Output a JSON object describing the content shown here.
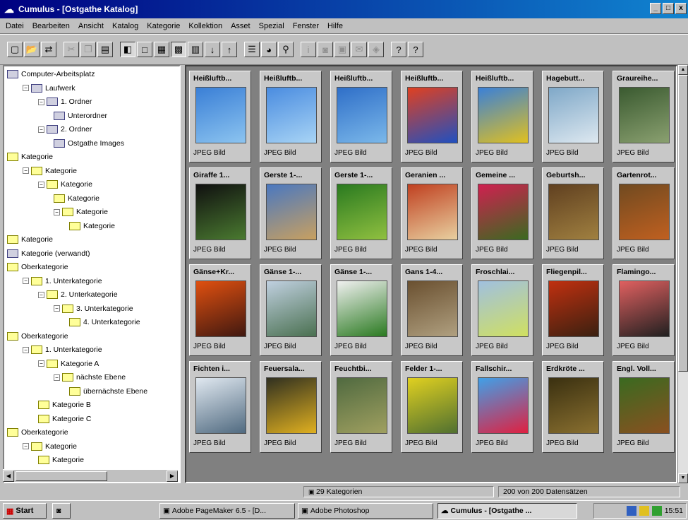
{
  "window": {
    "title": "Cumulus - [Ostgathe Katalog]",
    "min": "_",
    "max": "□",
    "close": "x"
  },
  "menu": [
    "Datei",
    "Bearbeiten",
    "Ansicht",
    "Katalog",
    "Kategorie",
    "Kollektion",
    "Asset",
    "Spezial",
    "Fenster",
    "Hilfe"
  ],
  "tree": [
    {
      "label": "Computer-Arbeitsplatz",
      "depth": 0,
      "exp": "",
      "type": "drive"
    },
    {
      "label": "Laufwerk",
      "depth": 1,
      "exp": "−",
      "type": "drive"
    },
    {
      "label": "1. Ordner",
      "depth": 2,
      "exp": "−",
      "type": "drive"
    },
    {
      "label": "Unterordner",
      "depth": 3,
      "exp": "",
      "type": "drive"
    },
    {
      "label": "2. Ordner",
      "depth": 2,
      "exp": "−",
      "type": "drive"
    },
    {
      "label": "Ostgathe Images",
      "depth": 3,
      "exp": "",
      "type": "drive"
    },
    {
      "label": "Kategorie",
      "depth": 0,
      "exp": "",
      "type": "folder"
    },
    {
      "label": "Kategorie",
      "depth": 1,
      "exp": "−",
      "type": "folder"
    },
    {
      "label": "Kategorie",
      "depth": 2,
      "exp": "−",
      "type": "folder"
    },
    {
      "label": "Kategorie",
      "depth": 3,
      "exp": "",
      "type": "folder"
    },
    {
      "label": "Kategorie",
      "depth": 3,
      "exp": "−",
      "type": "folder"
    },
    {
      "label": "Kategorie",
      "depth": 4,
      "exp": "",
      "type": "folder"
    },
    {
      "label": "Kategorie",
      "depth": 0,
      "exp": "",
      "type": "folder"
    },
    {
      "label": "Kategorie (verwandt)",
      "depth": 0,
      "exp": "",
      "type": "drive"
    },
    {
      "label": "Oberkategorie",
      "depth": 0,
      "exp": "",
      "type": "folder"
    },
    {
      "label": "1. Unterkategorie",
      "depth": 1,
      "exp": "−",
      "type": "folder"
    },
    {
      "label": "2. Unterkategorie",
      "depth": 2,
      "exp": "−",
      "type": "folder"
    },
    {
      "label": "3. Unterkategorie",
      "depth": 3,
      "exp": "−",
      "type": "folder"
    },
    {
      "label": "4. Unterkategorie",
      "depth": 4,
      "exp": "",
      "type": "folder"
    },
    {
      "label": "Oberkategorie",
      "depth": 0,
      "exp": "",
      "type": "folder"
    },
    {
      "label": "1. Unterkategorie",
      "depth": 1,
      "exp": "−",
      "type": "folder"
    },
    {
      "label": "Kategorie A",
      "depth": 2,
      "exp": "−",
      "type": "folder"
    },
    {
      "label": "nächste Ebene",
      "depth": 3,
      "exp": "−",
      "type": "folder"
    },
    {
      "label": "übernächste Ebene",
      "depth": 4,
      "exp": "",
      "type": "folder"
    },
    {
      "label": "Kategorie B",
      "depth": 2,
      "exp": "",
      "type": "folder"
    },
    {
      "label": "Kategorie C",
      "depth": 2,
      "exp": "",
      "type": "folder"
    },
    {
      "label": "Oberkategorie",
      "depth": 0,
      "exp": "",
      "type": "folder"
    },
    {
      "label": "Kategorie",
      "depth": 1,
      "exp": "−",
      "type": "folder"
    },
    {
      "label": "Kategorie",
      "depth": 2,
      "exp": "",
      "type": "folder"
    }
  ],
  "gallery": [
    {
      "name": "Heißluftb...",
      "kind": "JPEG Bild",
      "colors": [
        "#3a7fd6",
        "#8cc4f0"
      ]
    },
    {
      "name": "Heißluftb...",
      "kind": "JPEG Bild",
      "colors": [
        "#4a8ce0",
        "#a8d4f5"
      ]
    },
    {
      "name": "Heißluftb...",
      "kind": "JPEG Bild",
      "colors": [
        "#2f6fc8",
        "#7bb8ea"
      ]
    },
    {
      "name": "Heißluftb...",
      "kind": "JPEG Bild",
      "colors": [
        "#e04020",
        "#2050c0"
      ]
    },
    {
      "name": "Heißluftb...",
      "kind": "JPEG Bild",
      "colors": [
        "#3a80d8",
        "#e0c020"
      ]
    },
    {
      "name": "Hagebutt...",
      "kind": "JPEG Bild",
      "colors": [
        "#7fa8c8",
        "#dde8f0"
      ]
    },
    {
      "name": "Graureihe...",
      "kind": "JPEG Bild",
      "colors": [
        "#3a5a30",
        "#8aa070"
      ]
    },
    {
      "name": "Giraffe 1...",
      "kind": "JPEG Bild",
      "colors": [
        "#101010",
        "#4a7a30"
      ]
    },
    {
      "name": "Gerste 1-...",
      "kind": "JPEG Bild",
      "colors": [
        "#4a78c0",
        "#c8a060"
      ]
    },
    {
      "name": "Gerste 1-...",
      "kind": "JPEG Bild",
      "colors": [
        "#2a7a20",
        "#90c040"
      ]
    },
    {
      "name": "Geranien ...",
      "kind": "JPEG Bild",
      "colors": [
        "#c04020",
        "#e8d0a0"
      ]
    },
    {
      "name": "Gemeine ...",
      "kind": "JPEG Bild",
      "colors": [
        "#d02050",
        "#3a6a20"
      ]
    },
    {
      "name": "Geburtsh...",
      "kind": "JPEG Bild",
      "colors": [
        "#604020",
        "#a08040"
      ]
    },
    {
      "name": "Gartenrot...",
      "kind": "JPEG Bild",
      "colors": [
        "#704a20",
        "#c06020"
      ]
    },
    {
      "name": "Gänse+Kr...",
      "kind": "JPEG Bild",
      "colors": [
        "#e05010",
        "#401810"
      ]
    },
    {
      "name": "Gänse 1-...",
      "kind": "JPEG Bild",
      "colors": [
        "#c0d0e0",
        "#4a7050"
      ]
    },
    {
      "name": "Gänse 1-...",
      "kind": "JPEG Bild",
      "colors": [
        "#f0f0f0",
        "#2a7a20"
      ]
    },
    {
      "name": "Gans 1-4...",
      "kind": "JPEG Bild",
      "colors": [
        "#6a5030",
        "#b0a080"
      ]
    },
    {
      "name": "Froschlai...",
      "kind": "JPEG Bild",
      "colors": [
        "#a0c0e0",
        "#d0e060"
      ]
    },
    {
      "name": "Fliegenpil...",
      "kind": "JPEG Bild",
      "colors": [
        "#c03010",
        "#3a2010"
      ]
    },
    {
      "name": "Flamingo...",
      "kind": "JPEG Bild",
      "colors": [
        "#e06060",
        "#202020"
      ]
    },
    {
      "name": "Fichten i...",
      "kind": "JPEG Bild",
      "colors": [
        "#e0e8f0",
        "#506a80"
      ]
    },
    {
      "name": "Feuersala...",
      "kind": "JPEG Bild",
      "colors": [
        "#303020",
        "#e0b020"
      ]
    },
    {
      "name": "Feuchtbi...",
      "kind": "JPEG Bild",
      "colors": [
        "#506a40",
        "#a0a060"
      ]
    },
    {
      "name": "Felder 1-...",
      "kind": "JPEG Bild",
      "colors": [
        "#e0d020",
        "#507030"
      ]
    },
    {
      "name": "Fallschir...",
      "kind": "JPEG Bild",
      "colors": [
        "#40a0e8",
        "#e02040"
      ]
    },
    {
      "name": "Erdkröte ...",
      "kind": "JPEG Bild",
      "colors": [
        "#3a3010",
        "#8a7030"
      ]
    },
    {
      "name": "Engl. Voll...",
      "kind": "JPEG Bild",
      "colors": [
        "#3a6a20",
        "#8a5020"
      ]
    }
  ],
  "status": {
    "categories": "29 Kategorien",
    "records": "200 von 200 Datensätzen"
  },
  "taskbar": {
    "start": "Start",
    "tasks": [
      "Adobe PageMaker 6.5 - [D...",
      "Adobe Photoshop",
      "Cumulus - [Ostgathe ..."
    ],
    "clock": "15:51"
  }
}
